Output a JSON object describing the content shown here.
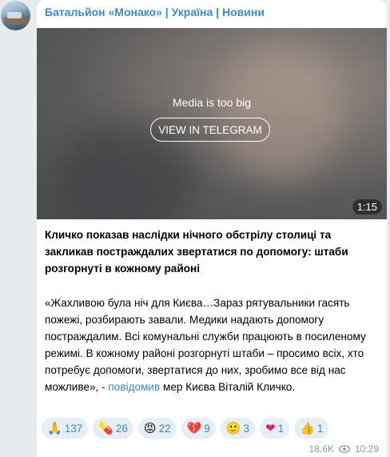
{
  "channel": {
    "name": "Батальйон «Монако» | Україна | Новини"
  },
  "media": {
    "notice": "Media is too big",
    "button_label": "VIEW IN TELEGRAM",
    "duration": "1:15"
  },
  "post": {
    "headline": "Кличко показав наслідки нічного обстрілу столиці та закликав постраждалих звертатися по допомогу: штаби розгорнуті в кожному районі",
    "body_before_link": "«Жахливою була ніч для Києва…Зараз рятувальники гасять пожежі, розбирають завали. Медики надають допомогу постраждалим. Всі комунальні служби працюють в посиленому режимі. В кожному районі розгорнуті штаби – просимо всіх, хто потребує допомоги, звертатися до них, зробимо все від нас можливе», - ",
    "link_text": "повідомив",
    "body_after_link": " мер Києва Віталій Кличко."
  },
  "reactions": [
    {
      "emoji": "🙏",
      "icon": "pray-icon",
      "count": "137"
    },
    {
      "emoji": "💊",
      "icon": "pill-icon",
      "count": "26"
    },
    {
      "emoji": "😡",
      "icon": "angry-face-icon",
      "count": "22"
    },
    {
      "emoji": "💔",
      "icon": "broken-heart-icon",
      "count": "9"
    },
    {
      "emoji": "🙂",
      "icon": "smirk-face-icon",
      "count": "3"
    },
    {
      "emoji": "❤",
      "icon": "heart-on-fire-icon",
      "count": "1"
    },
    {
      "emoji": "👍",
      "icon": "thumbs-up-icon",
      "count": "1"
    }
  ],
  "meta": {
    "views": "18.6K",
    "time": "10:29"
  },
  "colors": {
    "accent": "#3a8bc9",
    "reaction_bg": "#e7eef6",
    "page_bg": "#e6ebee"
  }
}
